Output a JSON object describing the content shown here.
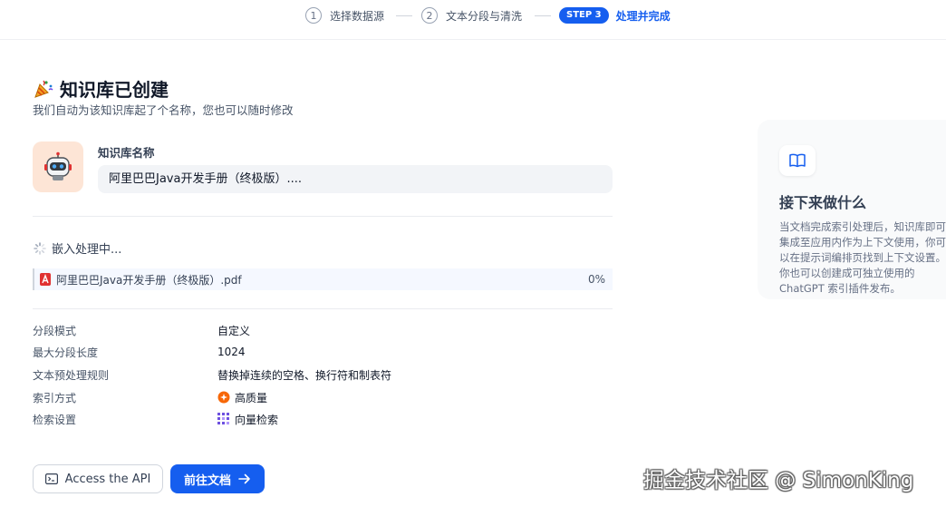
{
  "stepper": {
    "steps": [
      {
        "num": "1",
        "label": "选择数据源"
      },
      {
        "num": "2",
        "label": "文本分段与清洗"
      },
      {
        "badge": "STEP 3",
        "label": "处理并完成"
      }
    ]
  },
  "header": {
    "title": "知识库已创建",
    "subtitle": "我们自动为该知识库起了个名称，您也可以随时修改"
  },
  "kb_name": {
    "label": "知识库名称",
    "value": "阿里巴巴Java开发手册（终极版）...."
  },
  "embedding": {
    "status": "嵌入处理中...",
    "file_name": "阿里巴巴Java开发手册（终极版）.pdf",
    "progress": "0%"
  },
  "settings": [
    {
      "key": "分段模式",
      "value": "自定义"
    },
    {
      "key": "最大分段长度",
      "value": "1024"
    },
    {
      "key": "文本预处理规则",
      "value": "替换掉连续的空格、换行符和制表符"
    },
    {
      "key": "索引方式",
      "value": "高质量",
      "icon": "orange-star-icon"
    },
    {
      "key": "检索设置",
      "value": "向量检索",
      "icon": "vector-grid-icon"
    }
  ],
  "buttons": {
    "api": "Access the API",
    "doc": "前往文档"
  },
  "side_card": {
    "title": "接下来做什么",
    "text": "当文档完成索引处理后，知识库即可集成至应用内作为上下文使用，你可以在提示词编排页找到上下文设置。你也可以创建成可独立使用的 ChatGPT 索引插件发布。"
  },
  "watermark": "掘金技术社区 @ SimonKing",
  "colors": {
    "accent": "#155eef",
    "avatar_bg": "#fde5d6"
  }
}
